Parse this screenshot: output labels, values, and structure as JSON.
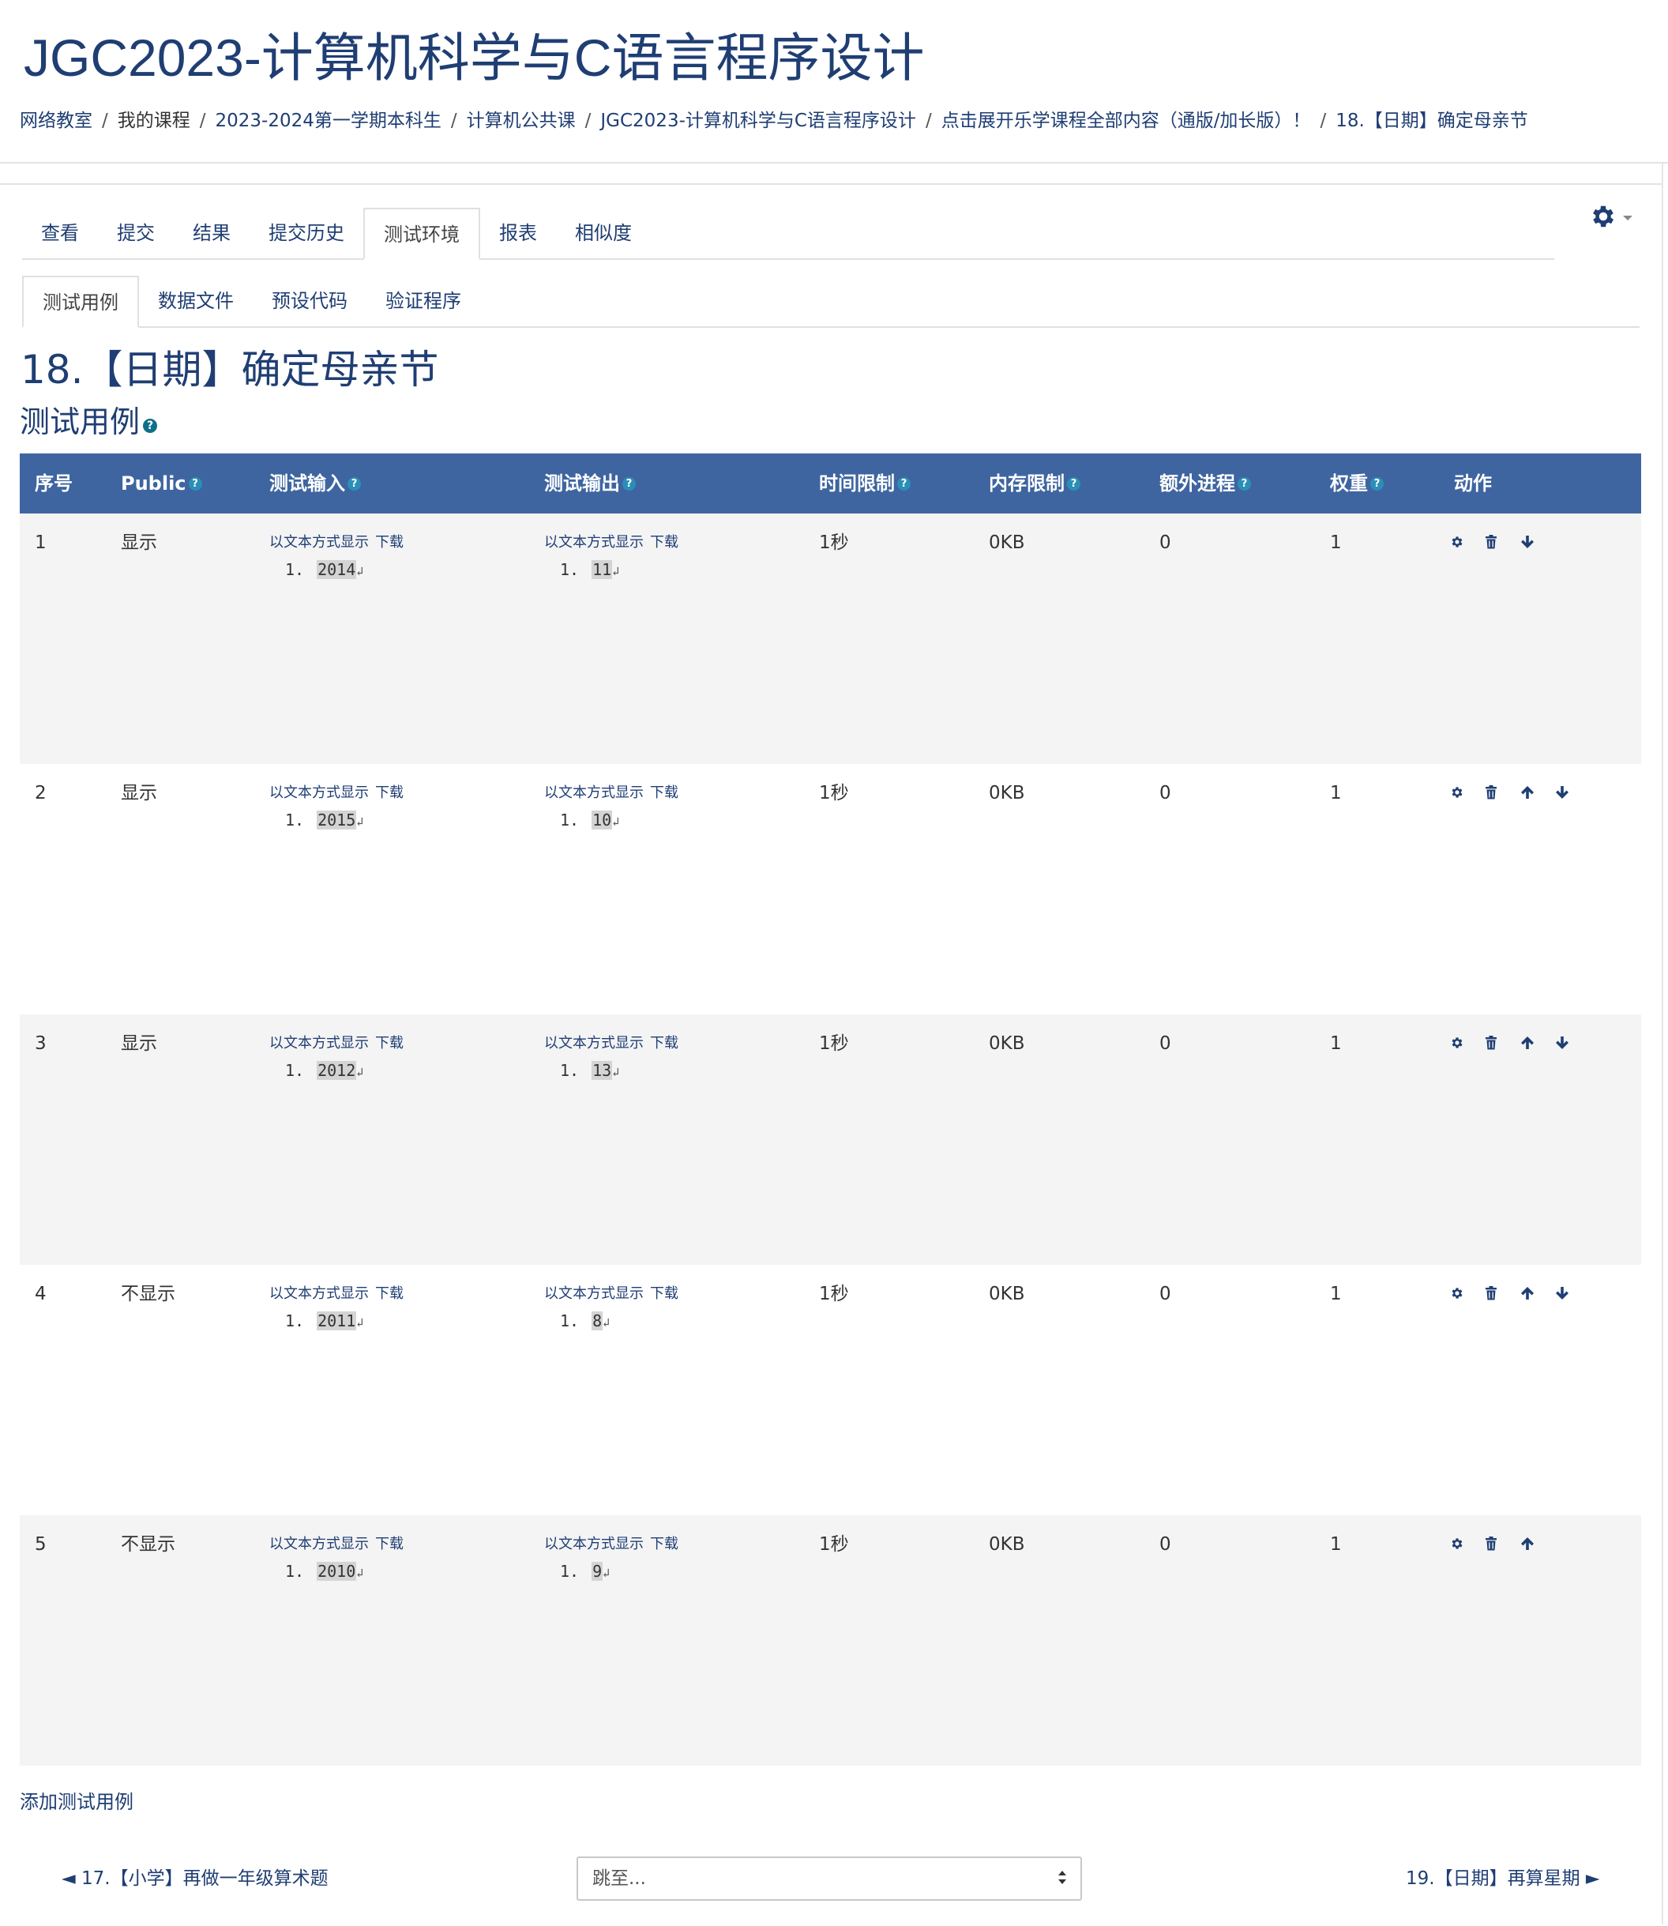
{
  "header": {
    "course_title": "JGC2023-计算机科学与C语言程序设计",
    "breadcrumb": [
      "网络教室",
      "我的课程",
      "2023-2024第一学期本科生",
      "计算机公共课",
      "JGC2023-计算机科学与C语言程序设计",
      "点击展开乐学课程全部内容（通版/加长版）！",
      "18.【日期】确定母亲节"
    ],
    "breadcrumb_separator": "/"
  },
  "settings": {
    "icon": "gear-icon"
  },
  "tabs_main": [
    {
      "label": "查看",
      "active": false
    },
    {
      "label": "提交",
      "active": false
    },
    {
      "label": "结果",
      "active": false
    },
    {
      "label": "提交历史",
      "active": false
    },
    {
      "label": "测试环境",
      "active": true
    },
    {
      "label": "报表",
      "active": false
    },
    {
      "label": "相似度",
      "active": false
    }
  ],
  "tabs_sub": [
    {
      "label": "测试用例",
      "active": true
    },
    {
      "label": "数据文件",
      "active": false
    },
    {
      "label": "预设代码",
      "active": false
    },
    {
      "label": "验证程序",
      "active": false
    }
  ],
  "problem_title": "18.【日期】确定母亲节",
  "section_title": "测试用例",
  "table": {
    "headers": {
      "seq": "序号",
      "public": "Public",
      "input": "测试输入",
      "output": "测试输出",
      "time": "时间限制",
      "memory": "内存限制",
      "extra": "额外进程",
      "weight": "权重",
      "action": "动作"
    },
    "show_as_text": "以文本方式显示",
    "download": "下载",
    "line_number": "1.",
    "return_glyph": "↲",
    "rows": [
      {
        "seq": "1",
        "public": "显示",
        "input": "2014",
        "output": "11",
        "time": "1秒",
        "memory": "0KB",
        "extra": "0",
        "weight": "1",
        "actions": [
          "gear-icon",
          "trash-icon",
          "arrow-down-icon"
        ]
      },
      {
        "seq": "2",
        "public": "显示",
        "input": "2015",
        "output": "10",
        "time": "1秒",
        "memory": "0KB",
        "extra": "0",
        "weight": "1",
        "actions": [
          "gear-icon",
          "trash-icon",
          "arrow-up-icon",
          "arrow-down-icon"
        ]
      },
      {
        "seq": "3",
        "public": "显示",
        "input": "2012",
        "output": "13",
        "time": "1秒",
        "memory": "0KB",
        "extra": "0",
        "weight": "1",
        "actions": [
          "gear-icon",
          "trash-icon",
          "arrow-up-icon",
          "arrow-down-icon"
        ]
      },
      {
        "seq": "4",
        "public": "不显示",
        "input": "2011",
        "output": "8",
        "time": "1秒",
        "memory": "0KB",
        "extra": "0",
        "weight": "1",
        "actions": [
          "gear-icon",
          "trash-icon",
          "arrow-up-icon",
          "arrow-down-icon"
        ]
      },
      {
        "seq": "5",
        "public": "不显示",
        "input": "2010",
        "output": "9",
        "time": "1秒",
        "memory": "0KB",
        "extra": "0",
        "weight": "1",
        "actions": [
          "gear-icon",
          "trash-icon",
          "arrow-up-icon"
        ]
      }
    ]
  },
  "add_testcase_label": "添加测试用例",
  "nav": {
    "prev_label": "◄ 17.【小学】再做一年级算术题",
    "next_label": "19.【日期】再算星期 ►",
    "jump_placeholder": "跳至..."
  },
  "colors": {
    "brand": "#1f3e73",
    "table_header": "#3e65a0",
    "help_icon": "#0f6f8a",
    "row_alt": "#f4f4f4"
  }
}
